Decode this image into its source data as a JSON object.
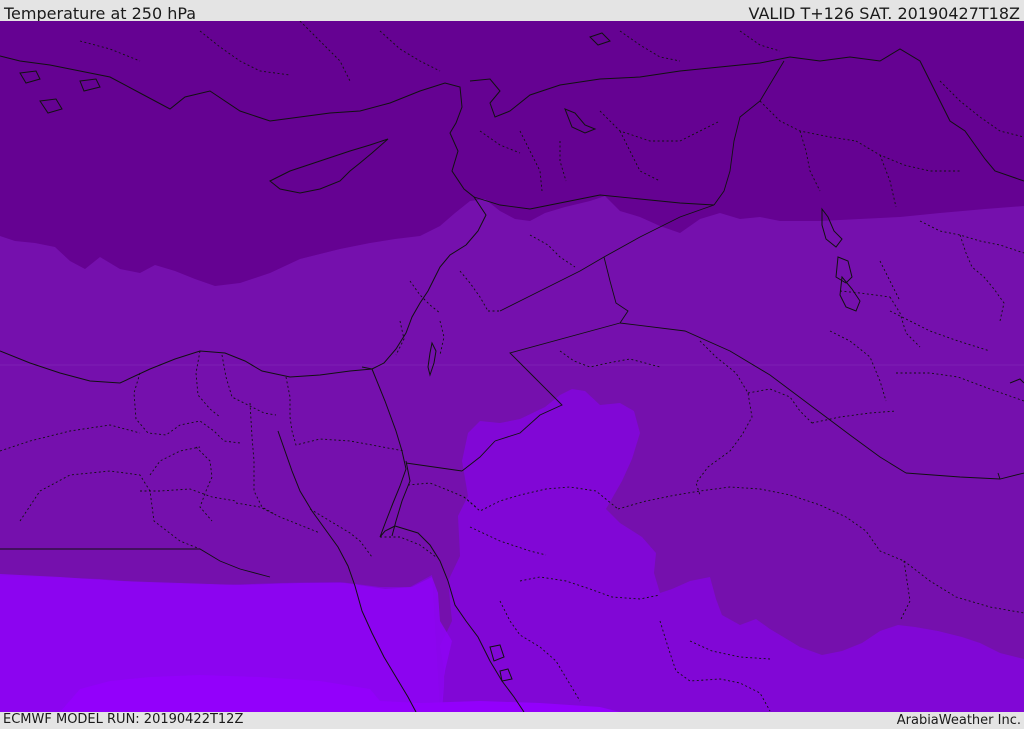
{
  "header": {
    "title": "Temperature at 250 hPa",
    "valid": "VALID T+126 SAT. 20190427T18Z"
  },
  "footer": {
    "model_run": "ECMWF MODEL RUN: 20190422T12Z",
    "credit": "ArabiaWeather Inc."
  },
  "map": {
    "colors": {
      "band_coldest": "#650292",
      "band_cold": "#7510ad",
      "band_mid": "#8107d6",
      "band_warm": "#8d04f3",
      "band_warmest": "#9300fb",
      "boundary_line": "#111111"
    }
  }
}
